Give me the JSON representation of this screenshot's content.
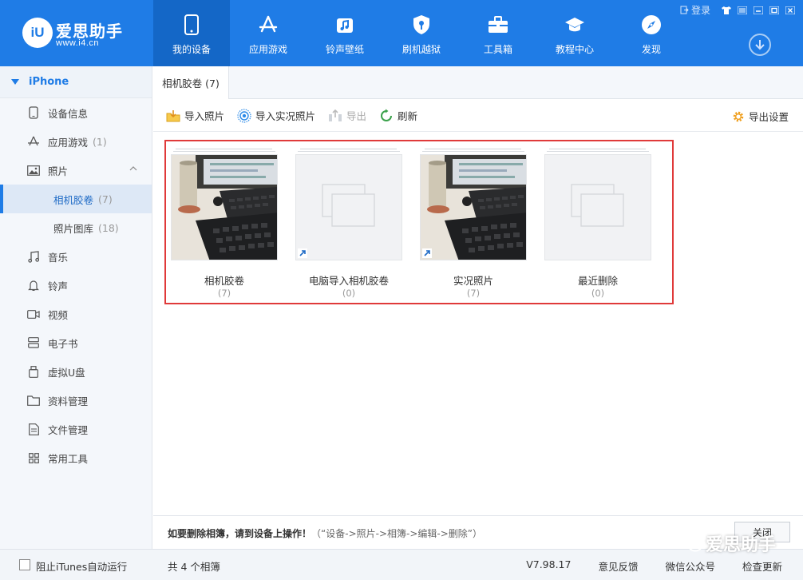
{
  "app": {
    "title": "爱思助手",
    "url": "www.i4.cn",
    "logo_mark": "iU"
  },
  "window": {
    "login": "登录"
  },
  "nav": [
    {
      "label": "我的设备",
      "icon": "phone-icon",
      "active": true
    },
    {
      "label": "应用游戏",
      "icon": "app-store-icon"
    },
    {
      "label": "铃声壁纸",
      "icon": "music-note-icon"
    },
    {
      "label": "刷机越狱",
      "icon": "shield-key-icon"
    },
    {
      "label": "工具箱",
      "icon": "toolbox-icon"
    },
    {
      "label": "教程中心",
      "icon": "graduation-cap-icon"
    },
    {
      "label": "发现",
      "icon": "compass-icon"
    }
  ],
  "sidebar": {
    "device": "iPhone",
    "items": [
      {
        "label": "设备信息",
        "icon": "phone-outline-icon"
      },
      {
        "label": "应用游戏",
        "count": "(1)",
        "icon": "app-store-icon"
      },
      {
        "label": "照片",
        "icon": "image-icon"
      },
      {
        "label": "相机胶卷",
        "count": "(7)",
        "sub": true,
        "active": true
      },
      {
        "label": "照片图库",
        "count": "(18)",
        "sub": true
      },
      {
        "label": "音乐",
        "icon": "music-note-icon"
      },
      {
        "label": "铃声",
        "icon": "bell-icon"
      },
      {
        "label": "视频",
        "icon": "video-camera-icon"
      },
      {
        "label": "电子书",
        "icon": "book-icon"
      },
      {
        "label": "虚拟U盘",
        "icon": "usb-drive-icon"
      },
      {
        "label": "资料管理",
        "icon": "folder-icon"
      },
      {
        "label": "文件管理",
        "icon": "file-icon"
      },
      {
        "label": "常用工具",
        "icon": "grid-icon"
      }
    ]
  },
  "tab": {
    "label": "相机胶卷 (7)"
  },
  "toolbar": {
    "import_photos": "导入照片",
    "import_live": "导入实况照片",
    "export": "导出",
    "refresh": "刷新",
    "export_settings": "导出设置"
  },
  "albums": [
    {
      "name": "相机胶卷",
      "count": "(7)",
      "has_photo": true,
      "live": false
    },
    {
      "name": "电脑导入相机胶卷",
      "count": "(0)",
      "has_photo": false,
      "live": true
    },
    {
      "name": "实况照片",
      "count": "(7)",
      "has_photo": true,
      "live": true
    },
    {
      "name": "最近删除",
      "count": "(0)",
      "has_photo": false,
      "live": false
    }
  ],
  "hint": {
    "bold": "如要删除相簿，请到设备上操作！",
    "path": "（“设备->照片->相簿->编辑->删除”）"
  },
  "close_button": "关闭",
  "status": {
    "block_itunes": "阻止iTunes自动运行",
    "album_total": "共 4 个相簿",
    "version": "V7.98.17",
    "feedback": "意见反馈",
    "wechat": "微信公众号",
    "check_update": "检查更新"
  },
  "watermark": "爱思助手",
  "colors": {
    "brand": "#1f7ce6",
    "highlight_border": "#e03a3a"
  }
}
